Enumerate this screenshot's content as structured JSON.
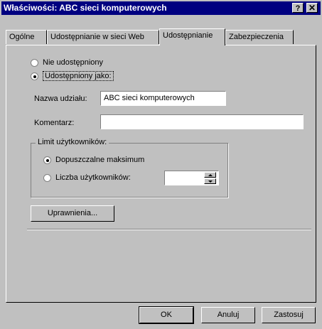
{
  "window": {
    "title": "Właściwości: ABC sieci komputerowych",
    "help_label": "?",
    "close_label": "✕"
  },
  "tabs": [
    {
      "label": "Ogólne",
      "active": false
    },
    {
      "label": "Udostępnianie w sieci Web",
      "active": false
    },
    {
      "label": "Udostępnianie",
      "active": true
    },
    {
      "label": "Zabezpieczenia",
      "active": false
    }
  ],
  "sharing": {
    "not_shared_label": "Nie udostępniony",
    "shared_as_label": "Udostępniony jako:",
    "selected": "shared_as",
    "share_name_label": "Nazwa udziału:",
    "share_name_value": "ABC sieci komputerowych",
    "comment_label": "Komentarz:",
    "comment_value": "",
    "user_limit": {
      "group_label": "Limit użytkowników:",
      "maximum_label": "Dopuszczalne maksimum",
      "count_label": "Liczba użytkowników:",
      "selected": "maximum",
      "count_value": ""
    },
    "permissions_button": "Uprawnienia..."
  },
  "buttons": {
    "ok": "OK",
    "cancel": "Anuluj",
    "apply": "Zastosuj"
  }
}
